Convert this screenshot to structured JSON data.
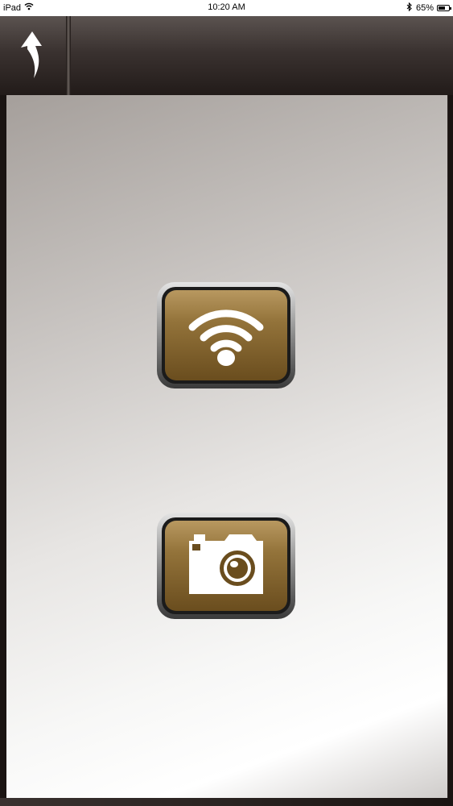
{
  "status_bar": {
    "device": "iPad",
    "time": "10:20 AM",
    "battery_percent": "65%",
    "battery_level": 0.65
  },
  "nav": {
    "back_icon": "curved-back-arrow-icon"
  },
  "main": {
    "buttons": [
      {
        "icon": "wifi-icon"
      },
      {
        "icon": "camera-icon"
      }
    ]
  },
  "colors": {
    "button_gold": "#93733a",
    "nav_bar": "#3a3230"
  }
}
